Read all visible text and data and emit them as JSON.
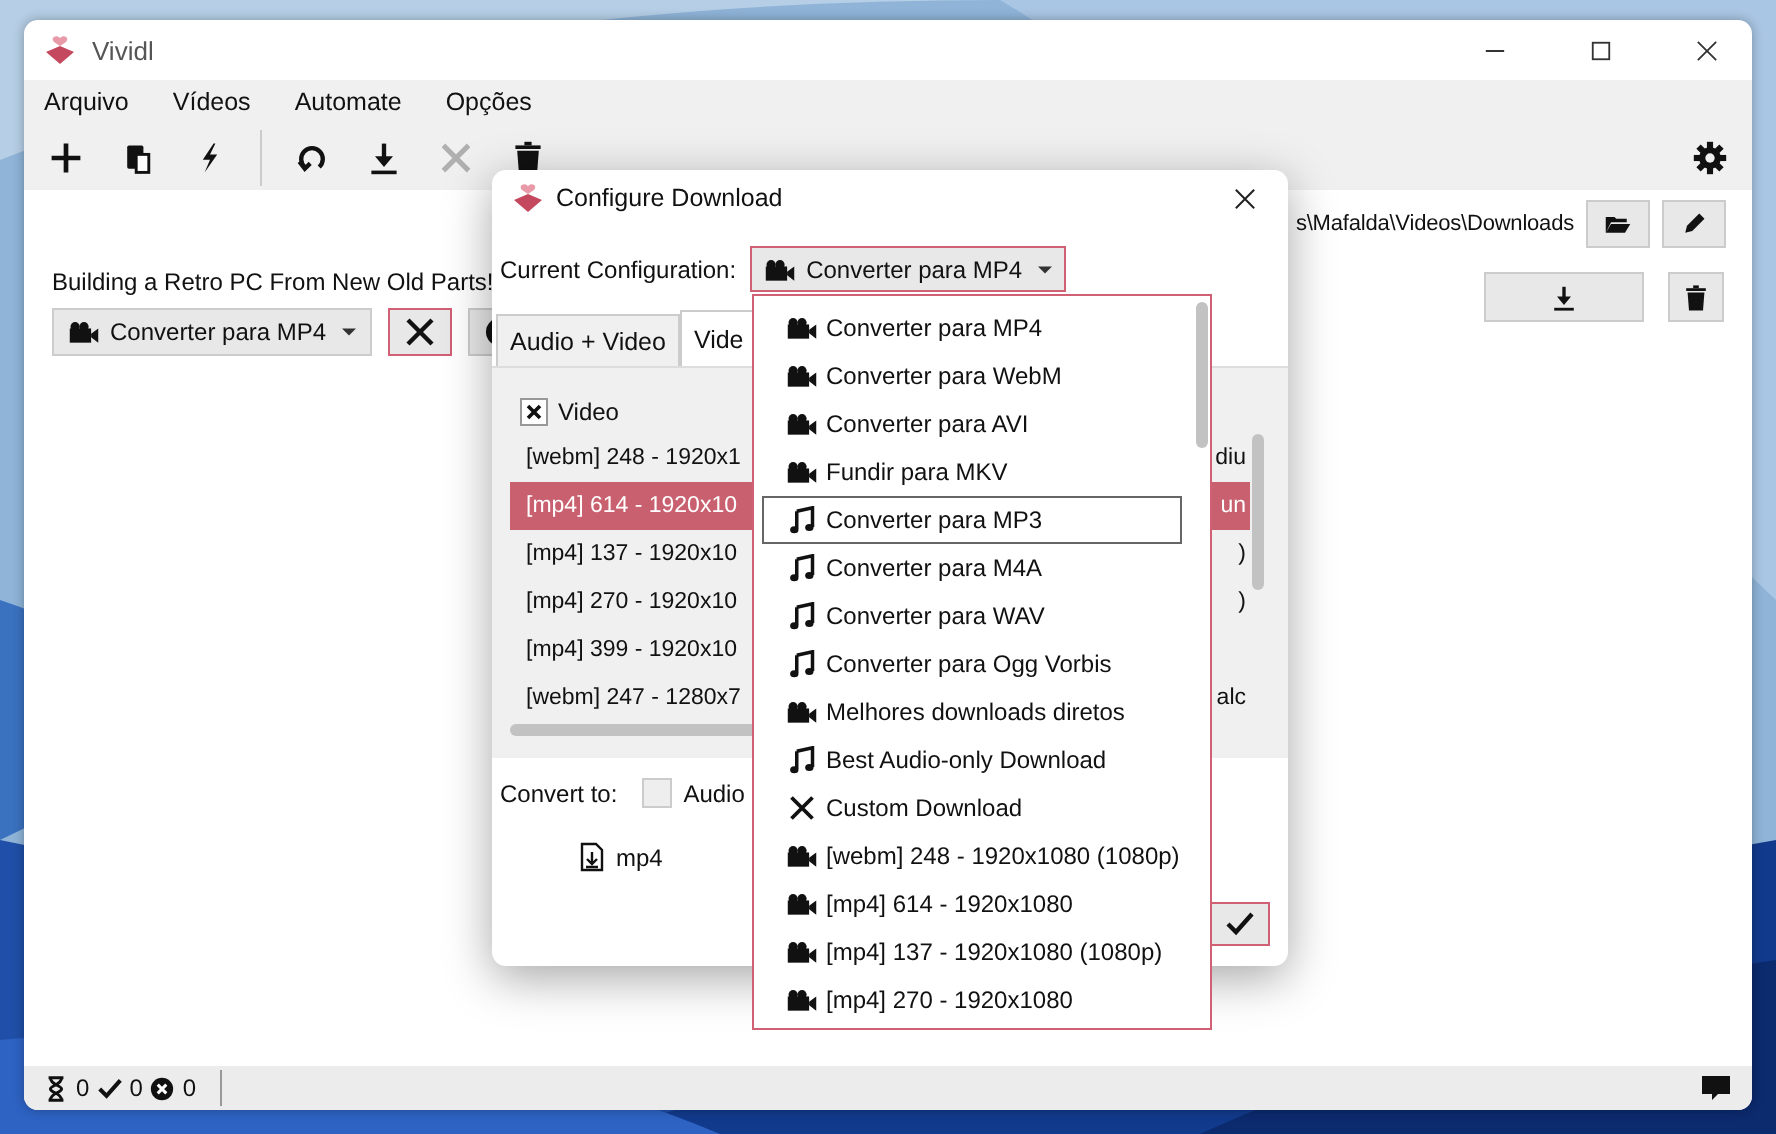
{
  "main_window": {
    "title": "Vividl",
    "menu": [
      "Arquivo",
      "Vídeos",
      "Automate",
      "Opções"
    ],
    "toolbar": [
      {
        "kind": "add",
        "disabled": false
      },
      {
        "kind": "paste",
        "disabled": false
      },
      {
        "kind": "quick",
        "disabled": false
      },
      {
        "kind": "separator"
      },
      {
        "kind": "refresh",
        "disabled": false
      },
      {
        "kind": "download",
        "disabled": false
      },
      {
        "kind": "cancel",
        "disabled": true
      },
      {
        "kind": "delete",
        "disabled": false
      }
    ],
    "download_folder": "s\\Mafalda\\Videos\\Downloads",
    "video": {
      "title": "Building a Retro PC From New Old Parts!",
      "preset": "Converter para MP4"
    },
    "status_bar": {
      "pending": "0",
      "done": "0",
      "failed": "0"
    }
  },
  "dialog": {
    "title": "Configure Download",
    "config_label": "Current Configuration:",
    "config_value": "Converter para MP4",
    "tabs": [
      {
        "label": "Audio + Video",
        "selected": false
      },
      {
        "label": "Vide",
        "selected": true
      }
    ],
    "video_checkbox": {
      "label": "Video",
      "checked": true
    },
    "formats": [
      {
        "text": "[webm] 248 - 1920x1",
        "tail": "diu",
        "selected": false
      },
      {
        "text": "[mp4] 614 - 1920x10",
        "tail": "un",
        "selected": true
      },
      {
        "text": "[mp4] 137 - 1920x10",
        "tail": ")",
        "selected": false
      },
      {
        "text": "[mp4] 270 - 1920x10",
        "tail": ")",
        "selected": false
      },
      {
        "text": "[mp4] 399 - 1920x10",
        "selected": false
      },
      {
        "text": "[webm] 247 - 1280x7",
        "tail": "alc",
        "selected": false
      }
    ],
    "convert_label": "Convert to:",
    "audio_only": {
      "label": "Audio",
      "checked": false
    },
    "extension": "mp4"
  },
  "dropdown": {
    "items": [
      {
        "kind": "video",
        "label": "Converter para MP4",
        "highlighted": false
      },
      {
        "kind": "video",
        "label": "Converter para WebM",
        "highlighted": false
      },
      {
        "kind": "video",
        "label": "Converter para AVI",
        "highlighted": false
      },
      {
        "kind": "video",
        "label": "Fundir para MKV",
        "highlighted": false
      },
      {
        "kind": "audio",
        "label": "Converter para MP3",
        "highlighted": true
      },
      {
        "kind": "audio",
        "label": "Converter para M4A",
        "highlighted": false
      },
      {
        "kind": "audio",
        "label": "Converter para WAV",
        "highlighted": false
      },
      {
        "kind": "audio",
        "label": "Converter para Ogg Vorbis",
        "highlighted": false
      },
      {
        "kind": "video",
        "label": "Melhores downloads diretos",
        "highlighted": false
      },
      {
        "kind": "audio",
        "label": "Best Audio-only Download",
        "highlighted": false
      },
      {
        "kind": "custom",
        "label": "Custom Download",
        "highlighted": false
      },
      {
        "kind": "video",
        "label": "[webm] 248 - 1920x1080 (1080p)",
        "highlighted": false
      },
      {
        "kind": "video",
        "label": "[mp4] 614 - 1920x1080",
        "highlighted": false
      },
      {
        "kind": "video",
        "label": "[mp4] 137 - 1920x1080 (1080p)",
        "highlighted": false
      },
      {
        "kind": "video",
        "label": "[mp4] 270 - 1920x1080",
        "highlighted": false
      }
    ]
  }
}
